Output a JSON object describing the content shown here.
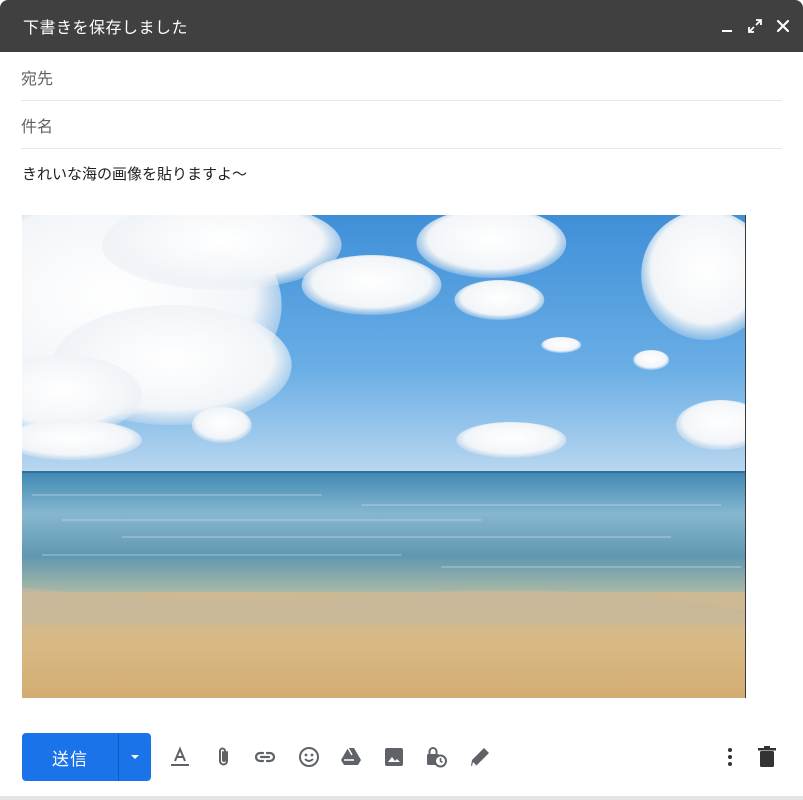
{
  "window": {
    "title": "下書きを保存しました",
    "controls": [
      "minimize-icon",
      "expand-icon",
      "close-icon"
    ]
  },
  "compose": {
    "to_label": "宛先",
    "to_value": "",
    "subject_label": "件名",
    "subject_value": "",
    "body_text": "きれいな海の画像を貼りますよ～"
  },
  "image": {
    "description_icon": "inline-beach-photo"
  },
  "toolbar": {
    "send_label": "送信",
    "icons": [
      "send-options-icon",
      "format-text-icon",
      "attach-file-icon",
      "insert-link-icon",
      "insert-emoji-icon",
      "google-drive-icon",
      "insert-photo-icon",
      "confidential-mode-icon",
      "insert-signature-icon",
      "more-options-icon",
      "discard-draft-icon"
    ]
  },
  "colors": {
    "titlebar": "#404040",
    "send_button": "#1a73e8",
    "icon": "#5f6368"
  }
}
